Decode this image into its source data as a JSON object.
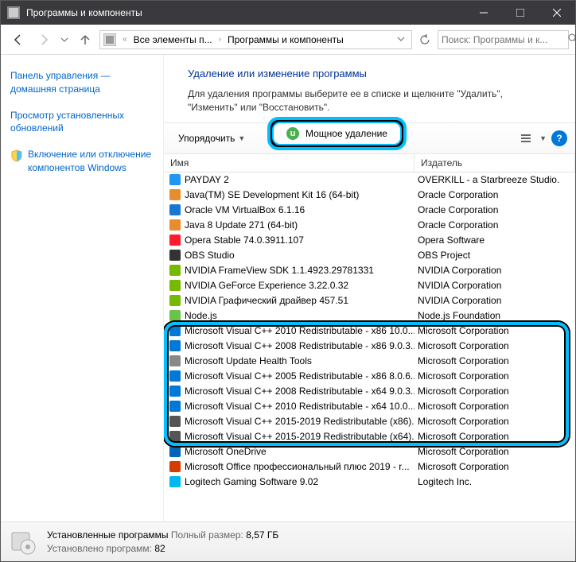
{
  "window": {
    "title": "Программы и компоненты"
  },
  "breadcrumb": {
    "item1": "Все элементы п...",
    "item2": "Программы и компоненты"
  },
  "search": {
    "placeholder": "Поиск: Программы и к..."
  },
  "sidebar": {
    "link1": "Панель управления — домашняя страница",
    "link2": "Просмотр установленных обновлений",
    "link3": "Включение или отключение компонентов Windows"
  },
  "main": {
    "heading": "Удаление или изменение программы",
    "desc": "Для удаления программы выберите ее в списке и щелкните \"Удалить\", \"Изменить\" или \"Восстановить\"."
  },
  "toolbar": {
    "organize": "Упорядочить",
    "powerful_uninstall": "Мощное удаление"
  },
  "columns": {
    "name": "Имя",
    "publisher": "Издатель"
  },
  "programs": [
    {
      "name": "PAYDAY 2",
      "publisher": "OVERKILL - a Starbreeze Studio.",
      "iconColor": "#2196f3"
    },
    {
      "name": "Java(TM) SE Development Kit 16 (64-bit)",
      "publisher": "Oracle Corporation",
      "iconColor": "#e88c30"
    },
    {
      "name": "Oracle VM VirtualBox 6.1.16",
      "publisher": "Oracle Corporation",
      "iconColor": "#1976d2"
    },
    {
      "name": "Java 8 Update 271 (64-bit)",
      "publisher": "Oracle Corporation",
      "iconColor": "#e88c30"
    },
    {
      "name": "Opera Stable 74.0.3911.107",
      "publisher": "Opera Software",
      "iconColor": "#ff1b2d"
    },
    {
      "name": "OBS Studio",
      "publisher": "OBS Project",
      "iconColor": "#333"
    },
    {
      "name": "NVIDIA FrameView SDK 1.1.4923.29781331",
      "publisher": "NVIDIA Corporation",
      "iconColor": "#76b900"
    },
    {
      "name": "NVIDIA GeForce Experience 3.22.0.32",
      "publisher": "NVIDIA Corporation",
      "iconColor": "#76b900"
    },
    {
      "name": "NVIDIA Графический драйвер 457.51",
      "publisher": "NVIDIA Corporation",
      "iconColor": "#76b900"
    },
    {
      "name": "Node.js",
      "publisher": "Node.js Foundation",
      "iconColor": "#6cc24a"
    },
    {
      "name": "Microsoft Visual C++ 2010 Redistributable - x86 10.0...",
      "publisher": "Microsoft Corporation",
      "iconColor": "#0078d7"
    },
    {
      "name": "Microsoft Visual C++ 2008 Redistributable - x86 9.0.3...",
      "publisher": "Microsoft Corporation",
      "iconColor": "#0078d7"
    },
    {
      "name": "Microsoft Update Health Tools",
      "publisher": "Microsoft Corporation",
      "iconColor": "#888"
    },
    {
      "name": "Microsoft Visual C++ 2005 Redistributable - x86 8.0.6...",
      "publisher": "Microsoft Corporation",
      "iconColor": "#0078d7"
    },
    {
      "name": "Microsoft Visual C++ 2008 Redistributable - x64 9.0.3...",
      "publisher": "Microsoft Corporation",
      "iconColor": "#0078d7"
    },
    {
      "name": "Microsoft Visual C++ 2010 Redistributable - x64 10.0...",
      "publisher": "Microsoft Corporation",
      "iconColor": "#0078d7"
    },
    {
      "name": "Microsoft Visual C++ 2015-2019 Redistributable (x86)...",
      "publisher": "Microsoft Corporation",
      "iconColor": "#555"
    },
    {
      "name": "Microsoft Visual C++ 2015-2019 Redistributable (x64)...",
      "publisher": "Microsoft Corporation",
      "iconColor": "#555"
    },
    {
      "name": "Microsoft OneDrive",
      "publisher": "Microsoft Corporation",
      "iconColor": "#0364b8"
    },
    {
      "name": "Microsoft Office профессиональный плюс 2019 - r...",
      "publisher": "Microsoft Corporation",
      "iconColor": "#d83b01"
    },
    {
      "name": "Logitech Gaming Software 9.02",
      "publisher": "Logitech Inc.",
      "iconColor": "#00b8f0"
    }
  ],
  "status": {
    "title": "Установленные программы",
    "size_label": "Полный размер:",
    "size_value": "8,57 ГБ",
    "count_label": "Установлено программ:",
    "count_value": "82"
  }
}
